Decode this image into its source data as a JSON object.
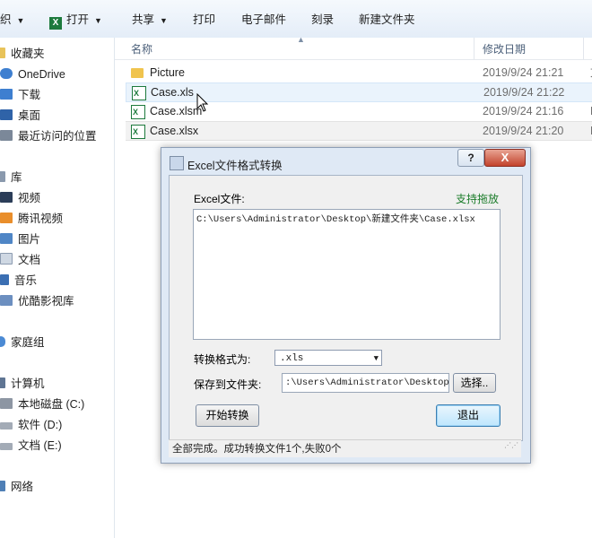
{
  "toolbar": {
    "partial_left": "织",
    "open_label": "打开",
    "share_label": "共享",
    "print_label": "打印",
    "email_label": "电子邮件",
    "burn_label": "刻录",
    "new_folder_label": "新建文件夹"
  },
  "nav": {
    "favorites": "收藏夹",
    "onedrive": "OneDrive",
    "downloads": "下载",
    "desktop": "桌面",
    "recent": "最近访问的位置",
    "libraries": "库",
    "videos": "视频",
    "tencent_video": "腾讯视频",
    "pictures": "图片",
    "documents": "文档",
    "music": "音乐",
    "youku": "优酷影视库",
    "homegroup": "家庭组",
    "computer": "计算机",
    "drive_c": "本地磁盘 (C:)",
    "drive_d": "软件 (D:)",
    "drive_e": "文档 (E:)",
    "network": "网络"
  },
  "list": {
    "header_name": "名称",
    "header_date": "修改日期",
    "files": [
      {
        "name": "Picture",
        "date": "2019/9/24 21:21",
        "type_char": "文",
        "icon": "folder-icon"
      },
      {
        "name": "Case.xls",
        "date": "2019/9/24 21:22",
        "type_char": "M",
        "icon": "excel-file-icon"
      },
      {
        "name": "Case.xlsm",
        "date": "2019/9/24 21:16",
        "type_char": "M",
        "icon": "excel-file-icon"
      },
      {
        "name": "Case.xlsx",
        "date": "2019/9/24 21:20",
        "type_char": "M",
        "icon": "excel-file-icon"
      }
    ]
  },
  "dialog": {
    "title": "Excel文件格式转换",
    "help_label": "?",
    "close_label": "X",
    "excel_file_label": "Excel文件:",
    "drag_hint": "支持拖放",
    "file_path": "C:\\Users\\Administrator\\Desktop\\新建文件夹\\Case.xlsx",
    "format_label": "转换格式为:",
    "format_value": ".xls",
    "save_folder_label": "保存到文件夹:",
    "save_folder_value": ":\\Users\\Administrator\\Desktop\\新",
    "browse_label": "选择..",
    "convert_label": "开始转换",
    "exit_label": "退出",
    "status": "全部完成。成功转换文件1个,失败0个"
  },
  "colors": {
    "accent_green": "#1b7c2a",
    "folder_yellow": "#f0c44e",
    "excel_green": "#1d7a3d"
  }
}
